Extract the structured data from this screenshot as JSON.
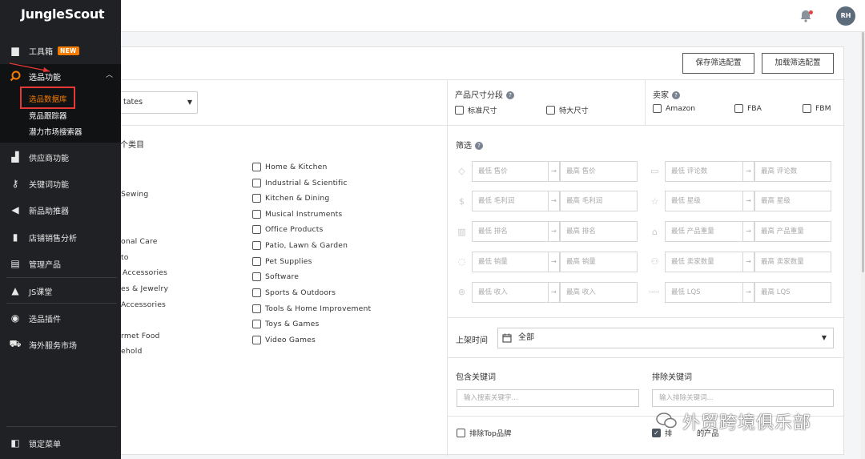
{
  "sidebar": {
    "brand": "JungleScout",
    "items": [
      {
        "label": "工具箱",
        "badge": "NEW",
        "icon": "toolbox-icon"
      },
      {
        "label": "选品功能",
        "icon": "search-icon"
      },
      {
        "label": "供应商功能",
        "icon": "factory-icon"
      },
      {
        "label": "关键词功能",
        "icon": "key-icon"
      },
      {
        "label": "新品助推器",
        "icon": "megaphone-icon"
      },
      {
        "label": "店铺销售分析",
        "icon": "bar-chart-icon"
      },
      {
        "label": "管理产品",
        "icon": "inbox-icon"
      },
      {
        "label": "JS课堂",
        "icon": "graduation-cap-icon"
      },
      {
        "label": "选品插件",
        "icon": "chrome-icon"
      },
      {
        "label": "海外服务市场",
        "icon": "cart-icon"
      }
    ],
    "subitems": [
      "选品数据库",
      "竞品跟踪器",
      "潜力市场搜索器"
    ],
    "lock_menu": "锁定菜单"
  },
  "header": {
    "avatar": "RH"
  },
  "actions": {
    "save_filter": "保存筛选配置",
    "load_filter": "加载筛选配置"
  },
  "marketplace": {
    "value": "tates"
  },
  "size_tier": {
    "label": "产品尺寸分段",
    "options": [
      "标准尺寸",
      "特大尺寸"
    ]
  },
  "seller": {
    "label": "卖家",
    "options": [
      "Amazon",
      "FBA",
      "FBM"
    ]
  },
  "categories": {
    "heading": "个类目",
    "left_col_fragments": [
      "Sewing",
      "onal Care",
      "to",
      "Accessories",
      "es & Jewelry",
      "Accessories",
      "rmet Food",
      "ehold"
    ],
    "right_col": [
      "Home & Kitchen",
      "Industrial & Scientific",
      "Kitchen & Dining",
      "Musical Instruments",
      "Office Products",
      "Patio, Lawn & Garden",
      "Pet Supplies",
      "Software",
      "Sports & Outdoors",
      "Tools & Home Improvement",
      "Toys & Games",
      "Video Games"
    ]
  },
  "filters": {
    "label": "筛选",
    "rows": [
      {
        "left": [
          "最低 售价",
          "最高 售价"
        ],
        "right": [
          "最低 评论数",
          "最高 评论数"
        ],
        "left_icon": "price-tag-icon",
        "right_icon": "review-icon"
      },
      {
        "left": [
          "最低 毛利润",
          "最高 毛利润"
        ],
        "right": [
          "最低 星级",
          "最高 星级"
        ],
        "left_icon": "money-bag-icon",
        "right_icon": "star-icon"
      },
      {
        "left": [
          "最低 排名",
          "最高 排名"
        ],
        "right": [
          "最低 产品重量",
          "最高 产品重量"
        ],
        "left_icon": "rank-icon",
        "right_icon": "weight-icon"
      },
      {
        "left": [
          "最低 销量",
          "最高 销量"
        ],
        "right": [
          "最低 卖家数量",
          "最高 卖家数量"
        ],
        "left_icon": "sales-icon",
        "right_icon": "sellers-icon"
      },
      {
        "left": [
          "最低 收入",
          "最高 收入"
        ],
        "right": [
          "最低 LQS",
          "最高 LQS"
        ],
        "left_icon": "revenue-icon",
        "right_icon": "lqs-icon"
      }
    ]
  },
  "listing_date": {
    "label": "上架时间",
    "value": "全部"
  },
  "keywords": {
    "include_label": "包含关键词",
    "include_placeholder": "输入搜索关键字...",
    "exclude_label": "排除关键词",
    "exclude_placeholder": "输入排除关键词..."
  },
  "exclude_top_brands": "排除Top品牌",
  "exclude_unavailable_fragment": "排",
  "exclude_unavailable_tail": "的产品",
  "watermark": "外贸跨境俱乐部"
}
